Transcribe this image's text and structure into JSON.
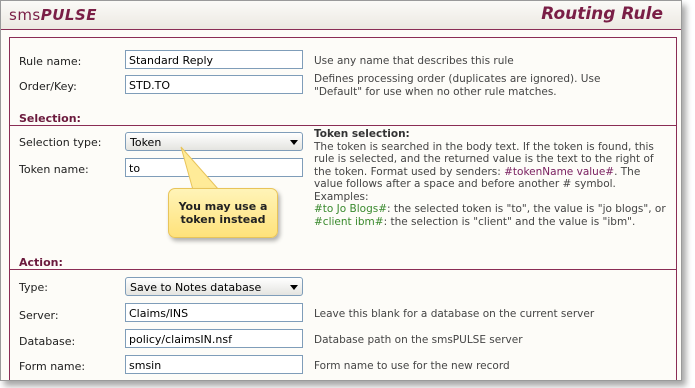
{
  "header": {
    "logo_light": "sms",
    "logo_bold": "PULSE",
    "title": "Routing Rule"
  },
  "rule_name": {
    "label": "Rule name:",
    "value": "Standard Reply",
    "desc": "Use any name that describes this rule"
  },
  "order_key": {
    "label": "Order/Key:",
    "value": "STD.TO",
    "desc_line1": "Defines processing order (duplicates are ignored). Use",
    "desc_line2": "\"Default\" for use when no other rule matches."
  },
  "selection": {
    "heading": "Selection:",
    "type_label": "Selection type:",
    "type_value": "Token",
    "token_label": "Token name:",
    "token_value": "to"
  },
  "help": {
    "title": "Token selection:",
    "p1_a": "The token is searched in the body text.  If the token is found, this rule is selected, and the returned value is the text to the right of the token.  Format used by senders: ",
    "p1_token": "#tokenName value#",
    "p1_b": ".  The value follows after a space and before another # symbol.  Examples:",
    "ex1_code": "#to Jo Blogs#",
    "ex1_text": ": the selected token is \"to\", the value is \"jo blogs\", or ",
    "ex2_code": "#client ibm#",
    "ex2_text": ": the selection is \"client\" and the value is \"ibm\"."
  },
  "callout": {
    "line1": "You may use a",
    "line2": "token instead"
  },
  "action": {
    "heading": "Action:",
    "type_label": "Type:",
    "type_value": "Save to Notes database",
    "server_label": "Server:",
    "server_value": "Claims/INS",
    "server_desc": "Leave this blank for a database on the current server",
    "db_label": "Database:",
    "db_value": "policy/claimsIN.nsf",
    "db_desc": "Database path on the smsPULSE server",
    "form_label": "Form name:",
    "form_value": "smsin",
    "form_desc": "Form name to use for the new record"
  },
  "colors": {
    "brand": "#7a1e46",
    "link_green": "#3a8a2e",
    "callout": "#ffe27a"
  }
}
